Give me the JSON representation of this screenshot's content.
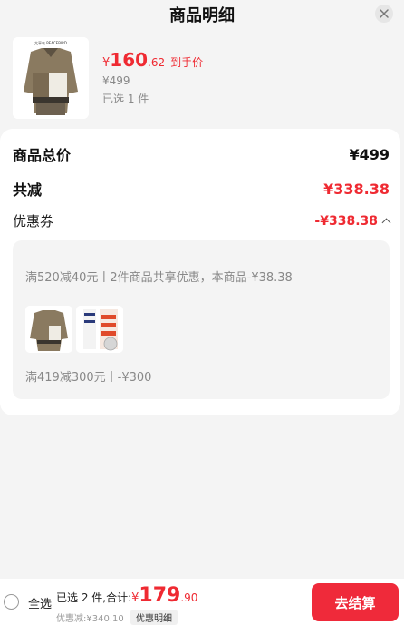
{
  "header": {
    "title": "商品明细"
  },
  "product": {
    "image_brand": "太平鸟 PEACEBIRD",
    "price_currency": "¥",
    "price_int": "160",
    "price_dec": ".62",
    "price_label": "到手价",
    "original_price": "¥499",
    "selected_count": "已选 1 件"
  },
  "summary": {
    "total_label": "商品总价",
    "total_value": "¥499",
    "discount_label": "共减",
    "discount_value": "¥338.38",
    "coupon_label": "优惠券",
    "coupon_value": "-¥338.38"
  },
  "coupons": {
    "line1": "满520减40元丨2件商品共享优惠，本商品-¥38.38",
    "line2": "满419减300元丨-¥300"
  },
  "footer": {
    "select_all": "全选",
    "selected_text": "已选 2 件,合计:",
    "currency": "¥",
    "total_int": "179",
    "total_dec": ".90",
    "discount_note": "优惠减:¥340.10",
    "detail_tag": "优惠明细",
    "checkout": "去结算"
  },
  "colors": {
    "accent": "#ef2a32",
    "checkout_bg": "#ef2a3a"
  }
}
